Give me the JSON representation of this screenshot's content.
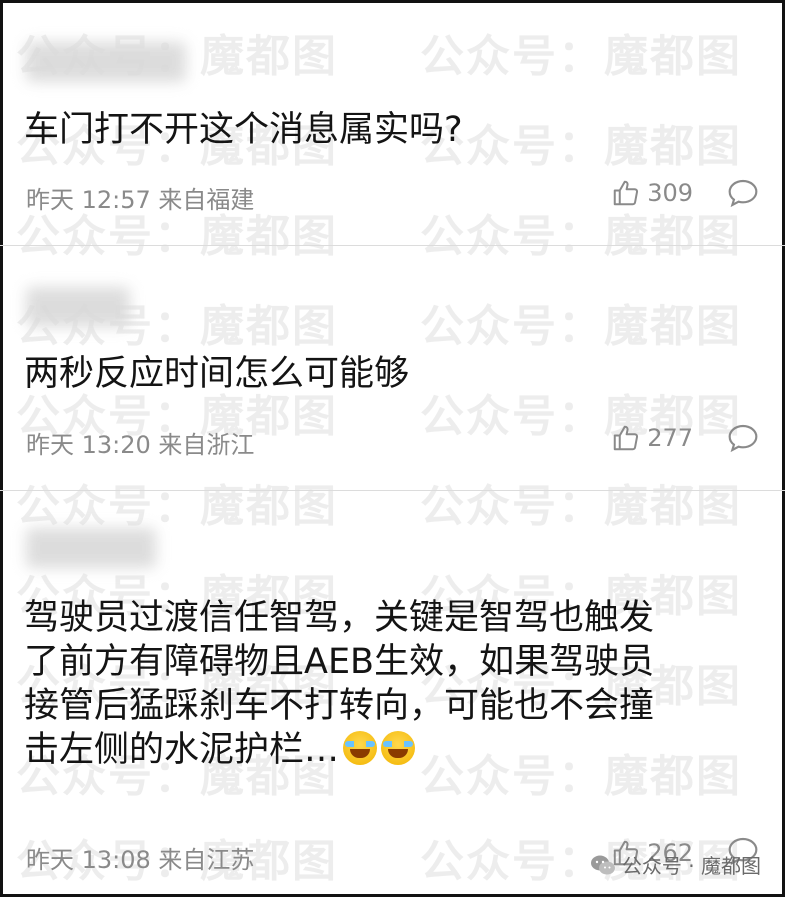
{
  "watermark": "公众号：魔都图",
  "comments": [
    {
      "text": "车门打不开这个消息属实吗?",
      "meta": "昨天 12:57 来自福建",
      "likes": "309"
    },
    {
      "text": "两秒反应时间怎么可能够",
      "meta": "昨天 13:20 来自浙江",
      "likes": "277"
    },
    {
      "text_lines": [
        "驾驶员过渡信任智驾，关键是智驾也触发",
        "了前方有障碍物且AEB生效，如果驾驶员",
        "接管后猛踩刹车不打转向，可能也不会撞",
        "击左侧的水泥护栏…"
      ],
      "meta": "昨天 13:08 来自江苏",
      "likes": "262"
    }
  ],
  "footer": {
    "label": "公众号 · 魔都图",
    "icon": "wechat-icon"
  },
  "colors": {
    "meta": "#8a8a8a",
    "text": "#141414",
    "divider": "#dcdcdc"
  }
}
